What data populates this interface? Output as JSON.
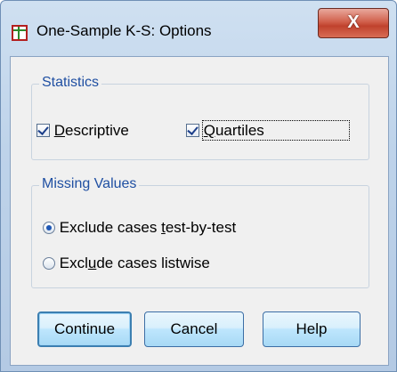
{
  "window": {
    "title": "One-Sample K-S: Options",
    "close_glyph": "X"
  },
  "statistics": {
    "legend": "Statistics",
    "descriptive": {
      "label_pre": "",
      "mnemonic": "D",
      "label_post": "escriptive",
      "checked": true
    },
    "quartiles": {
      "label_pre": "",
      "mnemonic": "Q",
      "label_post": "uartiles",
      "checked": true
    }
  },
  "missing_values": {
    "legend": "Missing Values",
    "test_by_test": {
      "label_pre": "Exclude cases ",
      "mnemonic": "t",
      "label_post": "est-by-test",
      "selected": true
    },
    "listwise": {
      "label_pre": "Excl",
      "mnemonic": "u",
      "label_post": "de cases listwise",
      "selected": false
    }
  },
  "buttons": {
    "continue": "Continue",
    "cancel": "Cancel",
    "help": "Help"
  },
  "colors": {
    "legend_text": "#1f4fa2",
    "close_button": "#c0422d",
    "button_accent": "#a7d9f5"
  }
}
